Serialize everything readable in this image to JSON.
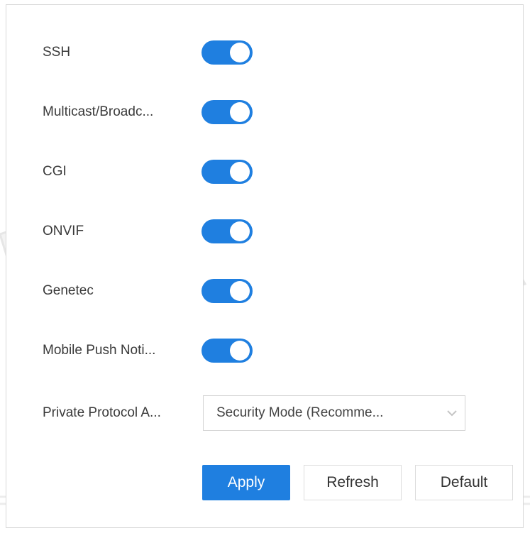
{
  "settings": {
    "toggles": [
      {
        "label": "SSH",
        "state": "on"
      },
      {
        "label": "Multicast/Broadc...",
        "state": "on"
      },
      {
        "label": "CGI",
        "state": "on"
      },
      {
        "label": "ONVIF",
        "state": "on"
      },
      {
        "label": "Genetec",
        "state": "on"
      },
      {
        "label": "Mobile Push Noti...",
        "state": "on"
      }
    ],
    "private_protocol": {
      "label": "Private Protocol A...",
      "value": "Security Mode (Recomme..."
    }
  },
  "actions": {
    "apply_label": "Apply",
    "refresh_label": "Refresh",
    "default_label": "Default"
  },
  "colors": {
    "accent": "#1f7fe0",
    "watermark": "#dcdcdc"
  },
  "icons": {
    "select_arrow": "chevron-down-icon"
  }
}
